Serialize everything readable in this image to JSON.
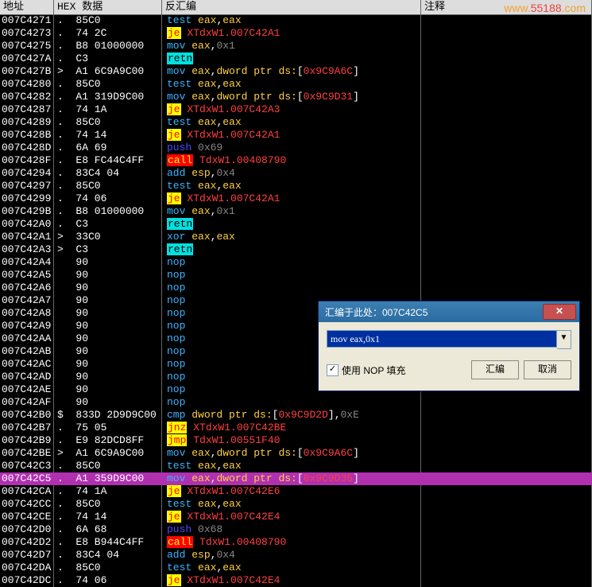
{
  "watermark_prefix": "www.",
  "watermark_host": "55188",
  "watermark_suffix": ".com",
  "headers": {
    "addr": "地址",
    "hex": "HEX 数据",
    "dis": "反汇编",
    "note": "注释"
  },
  "dialog": {
    "title": "汇编于此处：007C42C5",
    "input": "mov eax,0x1",
    "checkbox_label": "使用 NOP 填充",
    "ok": "汇编",
    "cancel": "取消"
  },
  "rows": [
    {
      "addr": "007C4271",
      "hex": ".  85C0",
      "tokens": [
        [
          "mn-test",
          "test"
        ],
        [
          "sp",
          " "
        ],
        [
          "reg",
          "eax"
        ],
        [
          "txt",
          ","
        ],
        [
          "reg",
          "eax"
        ]
      ]
    },
    {
      "addr": "007C4273",
      "hex": ".  74 2C",
      "tokens": [
        [
          "mn-je",
          "je"
        ],
        [
          "sp",
          " "
        ],
        [
          "sym",
          "XTdxW1.007C42A1"
        ]
      ]
    },
    {
      "addr": "007C4275",
      "hex": ".  B8 01000000",
      "tokens": [
        [
          "mn-mov",
          "mov"
        ],
        [
          "sp",
          " "
        ],
        [
          "reg",
          "eax"
        ],
        [
          "txt",
          ","
        ],
        [
          "num",
          "0x1"
        ]
      ]
    },
    {
      "addr": "007C427A",
      "hex": ".  C3",
      "tokens": [
        [
          "mn-retn",
          "retn"
        ]
      ]
    },
    {
      "addr": "007C427B",
      "hex": ">  A1 6C9A9C00",
      "tokens": [
        [
          "mn-mov",
          "mov"
        ],
        [
          "sp",
          " "
        ],
        [
          "reg",
          "eax"
        ],
        [
          "txt",
          ","
        ],
        [
          "mem",
          "dword ptr ds:"
        ],
        [
          "txt",
          "["
        ],
        [
          "mem-in",
          "0x9C9A6C"
        ],
        [
          "txt",
          "]"
        ]
      ]
    },
    {
      "addr": "007C4280",
      "hex": ".  85C0",
      "tokens": [
        [
          "mn-test",
          "test"
        ],
        [
          "sp",
          " "
        ],
        [
          "reg",
          "eax"
        ],
        [
          "txt",
          ","
        ],
        [
          "reg",
          "eax"
        ]
      ]
    },
    {
      "addr": "007C4282",
      "hex": ".  A1 319D9C00",
      "tokens": [
        [
          "mn-mov",
          "mov"
        ],
        [
          "sp",
          " "
        ],
        [
          "reg",
          "eax"
        ],
        [
          "txt",
          ","
        ],
        [
          "mem",
          "dword ptr ds:"
        ],
        [
          "txt",
          "["
        ],
        [
          "mem-in",
          "0x9C9D31"
        ],
        [
          "txt",
          "]"
        ]
      ]
    },
    {
      "addr": "007C4287",
      "hex": ".  74 1A",
      "tokens": [
        [
          "mn-je",
          "je"
        ],
        [
          "sp",
          " "
        ],
        [
          "sym",
          "XTdxW1.007C42A3"
        ]
      ]
    },
    {
      "addr": "007C4289",
      "hex": ".  85C0",
      "tokens": [
        [
          "mn-test",
          "test"
        ],
        [
          "sp",
          " "
        ],
        [
          "reg",
          "eax"
        ],
        [
          "txt",
          ","
        ],
        [
          "reg",
          "eax"
        ]
      ]
    },
    {
      "addr": "007C428B",
      "hex": ".  74 14",
      "tokens": [
        [
          "mn-je",
          "je"
        ],
        [
          "sp",
          " "
        ],
        [
          "sym",
          "XTdxW1.007C42A1"
        ]
      ]
    },
    {
      "addr": "007C428D",
      "hex": ".  6A 69",
      "tokens": [
        [
          "mn-push",
          "push"
        ],
        [
          "sp",
          " "
        ],
        [
          "num",
          "0x69"
        ]
      ]
    },
    {
      "addr": "007C428F",
      "hex": ".  E8 FC44C4FF",
      "tokens": [
        [
          "mn-call",
          "call"
        ],
        [
          "sp",
          " "
        ],
        [
          "sym",
          "TdxW1.00408790"
        ]
      ]
    },
    {
      "addr": "007C4294",
      "hex": ".  83C4 04",
      "tokens": [
        [
          "mn-add",
          "add"
        ],
        [
          "sp",
          " "
        ],
        [
          "reg",
          "esp"
        ],
        [
          "txt",
          ","
        ],
        [
          "num",
          "0x4"
        ]
      ]
    },
    {
      "addr": "007C4297",
      "hex": ".  85C0",
      "tokens": [
        [
          "mn-test",
          "test"
        ],
        [
          "sp",
          " "
        ],
        [
          "reg",
          "eax"
        ],
        [
          "txt",
          ","
        ],
        [
          "reg",
          "eax"
        ]
      ]
    },
    {
      "addr": "007C4299",
      "hex": ".  74 06",
      "tokens": [
        [
          "mn-je",
          "je"
        ],
        [
          "sp",
          " "
        ],
        [
          "sym",
          "XTdxW1.007C42A1"
        ]
      ]
    },
    {
      "addr": "007C429B",
      "hex": ".  B8 01000000",
      "tokens": [
        [
          "mn-mov",
          "mov"
        ],
        [
          "sp",
          " "
        ],
        [
          "reg",
          "eax"
        ],
        [
          "txt",
          ","
        ],
        [
          "num",
          "0x1"
        ]
      ]
    },
    {
      "addr": "007C42A0",
      "hex": ".  C3",
      "tokens": [
        [
          "mn-retn",
          "retn"
        ]
      ]
    },
    {
      "addr": "007C42A1",
      "hex": ">  33C0",
      "tokens": [
        [
          "mn-xor",
          "xor"
        ],
        [
          "sp",
          " "
        ],
        [
          "reg",
          "eax"
        ],
        [
          "txt",
          ","
        ],
        [
          "reg",
          "eax"
        ]
      ]
    },
    {
      "addr": "007C42A3",
      "hex": ">  C3",
      "tokens": [
        [
          "mn-retn",
          "retn"
        ]
      ]
    },
    {
      "addr": "007C42A4",
      "hex": "   90",
      "tokens": [
        [
          "mn-nop",
          "nop"
        ]
      ]
    },
    {
      "addr": "007C42A5",
      "hex": "   90",
      "tokens": [
        [
          "mn-nop",
          "nop"
        ]
      ]
    },
    {
      "addr": "007C42A6",
      "hex": "   90",
      "tokens": [
        [
          "mn-nop",
          "nop"
        ]
      ]
    },
    {
      "addr": "007C42A7",
      "hex": "   90",
      "tokens": [
        [
          "mn-nop",
          "nop"
        ]
      ]
    },
    {
      "addr": "007C42A8",
      "hex": "   90",
      "tokens": [
        [
          "mn-nop",
          "nop"
        ]
      ]
    },
    {
      "addr": "007C42A9",
      "hex": "   90",
      "tokens": [
        [
          "mn-nop",
          "nop"
        ]
      ]
    },
    {
      "addr": "007C42AA",
      "hex": "   90",
      "tokens": [
        [
          "mn-nop",
          "nop"
        ]
      ]
    },
    {
      "addr": "007C42AB",
      "hex": "   90",
      "tokens": [
        [
          "mn-nop",
          "nop"
        ]
      ]
    },
    {
      "addr": "007C42AC",
      "hex": "   90",
      "tokens": [
        [
          "mn-nop",
          "nop"
        ]
      ]
    },
    {
      "addr": "007C42AD",
      "hex": "   90",
      "tokens": [
        [
          "mn-nop",
          "nop"
        ]
      ]
    },
    {
      "addr": "007C42AE",
      "hex": "   90",
      "tokens": [
        [
          "mn-nop",
          "nop"
        ]
      ]
    },
    {
      "addr": "007C42AF",
      "hex": "   90",
      "tokens": [
        [
          "mn-nop",
          "nop"
        ]
      ]
    },
    {
      "addr": "007C42B0",
      "hex": "$  833D 2D9D9C00",
      "tokens": [
        [
          "mn-cmp",
          "cmp"
        ],
        [
          "sp",
          " "
        ],
        [
          "mem",
          "dword ptr ds:"
        ],
        [
          "txt",
          "["
        ],
        [
          "mem-in",
          "0x9C9D2D"
        ],
        [
          "txt",
          "]"
        ],
        [
          "txt",
          ","
        ],
        [
          "num",
          "0xE"
        ]
      ]
    },
    {
      "addr": "007C42B7",
      "hex": ".  75 05",
      "tokens": [
        [
          "mn-jnz",
          "jnz"
        ],
        [
          "sp",
          " "
        ],
        [
          "sym",
          "XTdxW1.007C42BE"
        ]
      ]
    },
    {
      "addr": "007C42B9",
      "hex": ".  E9 82DCD8FF",
      "tokens": [
        [
          "mn-jmp",
          "jmp"
        ],
        [
          "sp",
          " "
        ],
        [
          "sym",
          "TdxW1.00551F40"
        ]
      ]
    },
    {
      "addr": "007C42BE",
      "hex": ">  A1 6C9A9C00",
      "tokens": [
        [
          "mn-mov",
          "mov"
        ],
        [
          "sp",
          " "
        ],
        [
          "reg",
          "eax"
        ],
        [
          "txt",
          ","
        ],
        [
          "mem",
          "dword ptr ds:"
        ],
        [
          "txt",
          "["
        ],
        [
          "mem-in",
          "0x9C9A6C"
        ],
        [
          "txt",
          "]"
        ]
      ]
    },
    {
      "addr": "007C42C3",
      "hex": ".  85C0",
      "tokens": [
        [
          "mn-test",
          "test"
        ],
        [
          "sp",
          " "
        ],
        [
          "reg",
          "eax"
        ],
        [
          "txt",
          ","
        ],
        [
          "reg",
          "eax"
        ]
      ]
    },
    {
      "addr": "007C42C5",
      "hex": ".  A1 359D9C00",
      "sel": true,
      "tokens": [
        [
          "mn-mov",
          "mov"
        ],
        [
          "sp",
          " "
        ],
        [
          "reg",
          "eax"
        ],
        [
          "txt",
          ","
        ],
        [
          "mem",
          "dword ptr ds:"
        ],
        [
          "txt",
          "["
        ],
        [
          "mem-in",
          "0x9C9D35"
        ],
        [
          "txt",
          "]"
        ]
      ]
    },
    {
      "addr": "007C42CA",
      "hex": ".  74 1A",
      "tokens": [
        [
          "mn-je",
          "je"
        ],
        [
          "sp",
          " "
        ],
        [
          "sym",
          "XTdxW1.007C42E6"
        ]
      ]
    },
    {
      "addr": "007C42CC",
      "hex": ".  85C0",
      "tokens": [
        [
          "mn-test",
          "test"
        ],
        [
          "sp",
          " "
        ],
        [
          "reg",
          "eax"
        ],
        [
          "txt",
          ","
        ],
        [
          "reg",
          "eax"
        ]
      ]
    },
    {
      "addr": "007C42CE",
      "hex": ".  74 14",
      "tokens": [
        [
          "mn-je",
          "je"
        ],
        [
          "sp",
          " "
        ],
        [
          "sym",
          "XTdxW1.007C42E4"
        ]
      ]
    },
    {
      "addr": "007C42D0",
      "hex": ".  6A 68",
      "tokens": [
        [
          "mn-push",
          "push"
        ],
        [
          "sp",
          " "
        ],
        [
          "num",
          "0x68"
        ]
      ]
    },
    {
      "addr": "007C42D2",
      "hex": ".  E8 B944C4FF",
      "tokens": [
        [
          "mn-call",
          "call"
        ],
        [
          "sp",
          " "
        ],
        [
          "sym",
          "TdxW1.00408790"
        ]
      ]
    },
    {
      "addr": "007C42D7",
      "hex": ".  83C4 04",
      "tokens": [
        [
          "mn-add",
          "add"
        ],
        [
          "sp",
          " "
        ],
        [
          "reg",
          "esp"
        ],
        [
          "txt",
          ","
        ],
        [
          "num",
          "0x4"
        ]
      ]
    },
    {
      "addr": "007C42DA",
      "hex": ".  85C0",
      "tokens": [
        [
          "mn-test",
          "test"
        ],
        [
          "sp",
          " "
        ],
        [
          "reg",
          "eax"
        ],
        [
          "txt",
          ","
        ],
        [
          "reg",
          "eax"
        ]
      ]
    },
    {
      "addr": "007C42DC",
      "hex": ".  74 06",
      "tokens": [
        [
          "mn-je",
          "je"
        ],
        [
          "sp",
          " "
        ],
        [
          "sym",
          "XTdxW1.007C42E4"
        ]
      ]
    }
  ]
}
